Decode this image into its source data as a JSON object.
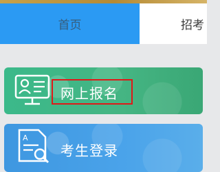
{
  "tabs": [
    {
      "label": "首页",
      "active": true
    },
    {
      "label": "招考",
      "active": false
    }
  ],
  "tiles": [
    {
      "label": "网上报名",
      "icon": "computer-user-icon",
      "highlighted": true
    },
    {
      "label": "考生登录",
      "icon": "document-search-icon",
      "highlighted": false
    }
  ],
  "colors": {
    "tab_active": "#2b9af3",
    "tile_green": "#3bb98a",
    "tile_blue": "#3e97e0",
    "highlight_border": "#e01818",
    "background": "#e7e8ea"
  }
}
